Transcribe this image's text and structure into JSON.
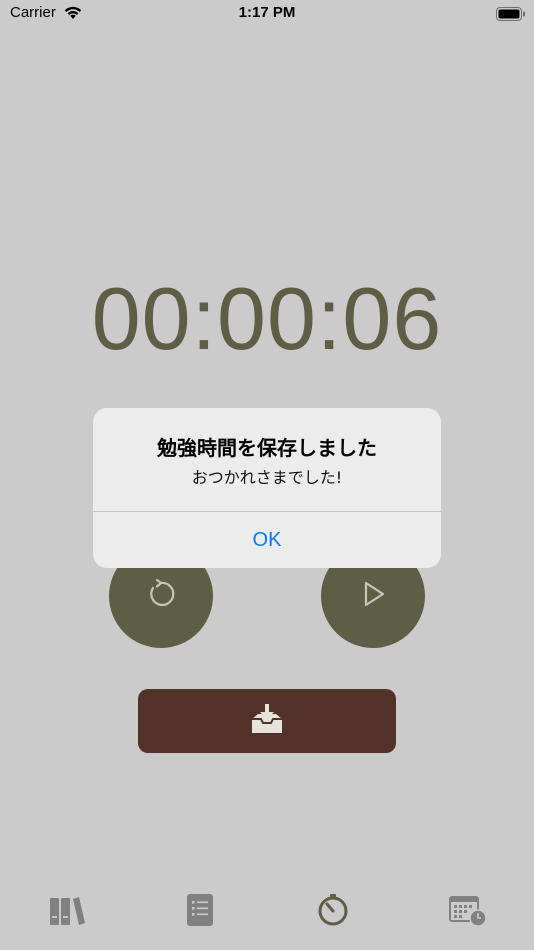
{
  "status_bar": {
    "carrier": "Carrier",
    "time": "1:17 PM"
  },
  "timer": {
    "display": "00:00:06"
  },
  "controls": {
    "reset_icon": "reset-icon",
    "play_icon": "play-icon",
    "save_icon": "inbox-download-icon"
  },
  "tab_bar": {
    "items": [
      {
        "icon": "books-icon"
      },
      {
        "icon": "list-icon"
      },
      {
        "icon": "timer-icon"
      },
      {
        "icon": "calendar-clock-icon"
      }
    ]
  },
  "alert": {
    "title": "勉強時間を保存しました",
    "message": "おつかれさまでした!",
    "ok_label": "OK"
  },
  "colors": {
    "background": "#cbcbcb",
    "accent": "#5e5d46",
    "save": "#533329",
    "link": "#0a7aff"
  }
}
